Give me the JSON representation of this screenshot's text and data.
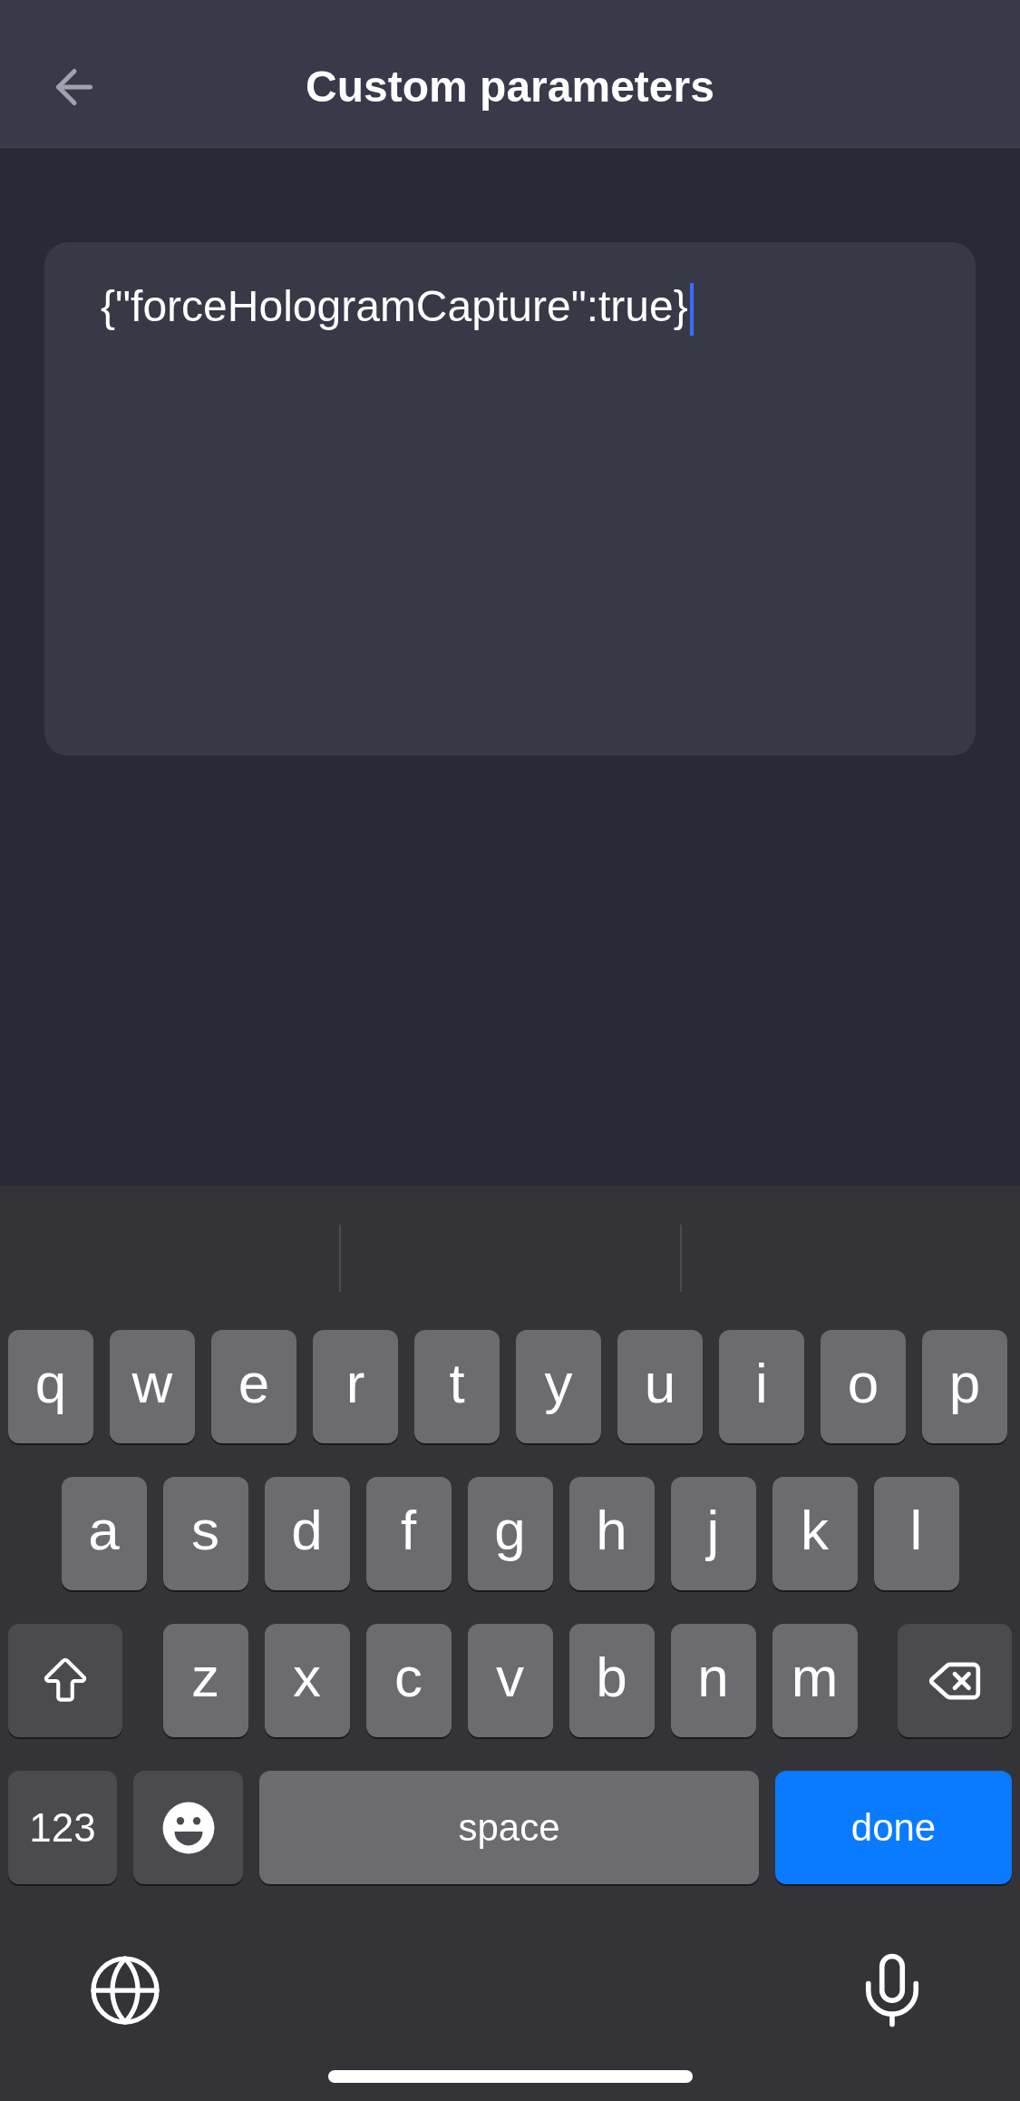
{
  "header": {
    "title": "Custom parameters"
  },
  "editor": {
    "value": "{\"forceHologramCapture\":true}",
    "focused": true
  },
  "keyboard": {
    "rows": [
      {
        "keys": [
          {
            "kind": "letter",
            "label": "q"
          },
          {
            "kind": "letter",
            "label": "w"
          },
          {
            "kind": "letter",
            "label": "e"
          },
          {
            "kind": "letter",
            "label": "r"
          },
          {
            "kind": "letter",
            "label": "t"
          },
          {
            "kind": "letter",
            "label": "y"
          },
          {
            "kind": "letter",
            "label": "u"
          },
          {
            "kind": "letter",
            "label": "i"
          },
          {
            "kind": "letter",
            "label": "o"
          },
          {
            "kind": "letter",
            "label": "p"
          }
        ]
      },
      {
        "keys": [
          {
            "kind": "letter",
            "label": "a"
          },
          {
            "kind": "letter",
            "label": "s"
          },
          {
            "kind": "letter",
            "label": "d"
          },
          {
            "kind": "letter",
            "label": "f"
          },
          {
            "kind": "letter",
            "label": "g"
          },
          {
            "kind": "letter",
            "label": "h"
          },
          {
            "kind": "letter",
            "label": "j"
          },
          {
            "kind": "letter",
            "label": "k"
          },
          {
            "kind": "letter",
            "label": "l"
          }
        ]
      },
      {
        "keys": [
          {
            "kind": "shift"
          },
          {
            "kind": "letter",
            "label": "z"
          },
          {
            "kind": "letter",
            "label": "x"
          },
          {
            "kind": "letter",
            "label": "c"
          },
          {
            "kind": "letter",
            "label": "v"
          },
          {
            "kind": "letter",
            "label": "b"
          },
          {
            "kind": "letter",
            "label": "n"
          },
          {
            "kind": "letter",
            "label": "m"
          },
          {
            "kind": "backspace"
          }
        ]
      }
    ],
    "bottom_bar": {
      "numbers_key": "123",
      "space_key": "space",
      "done_key": "done"
    }
  }
}
